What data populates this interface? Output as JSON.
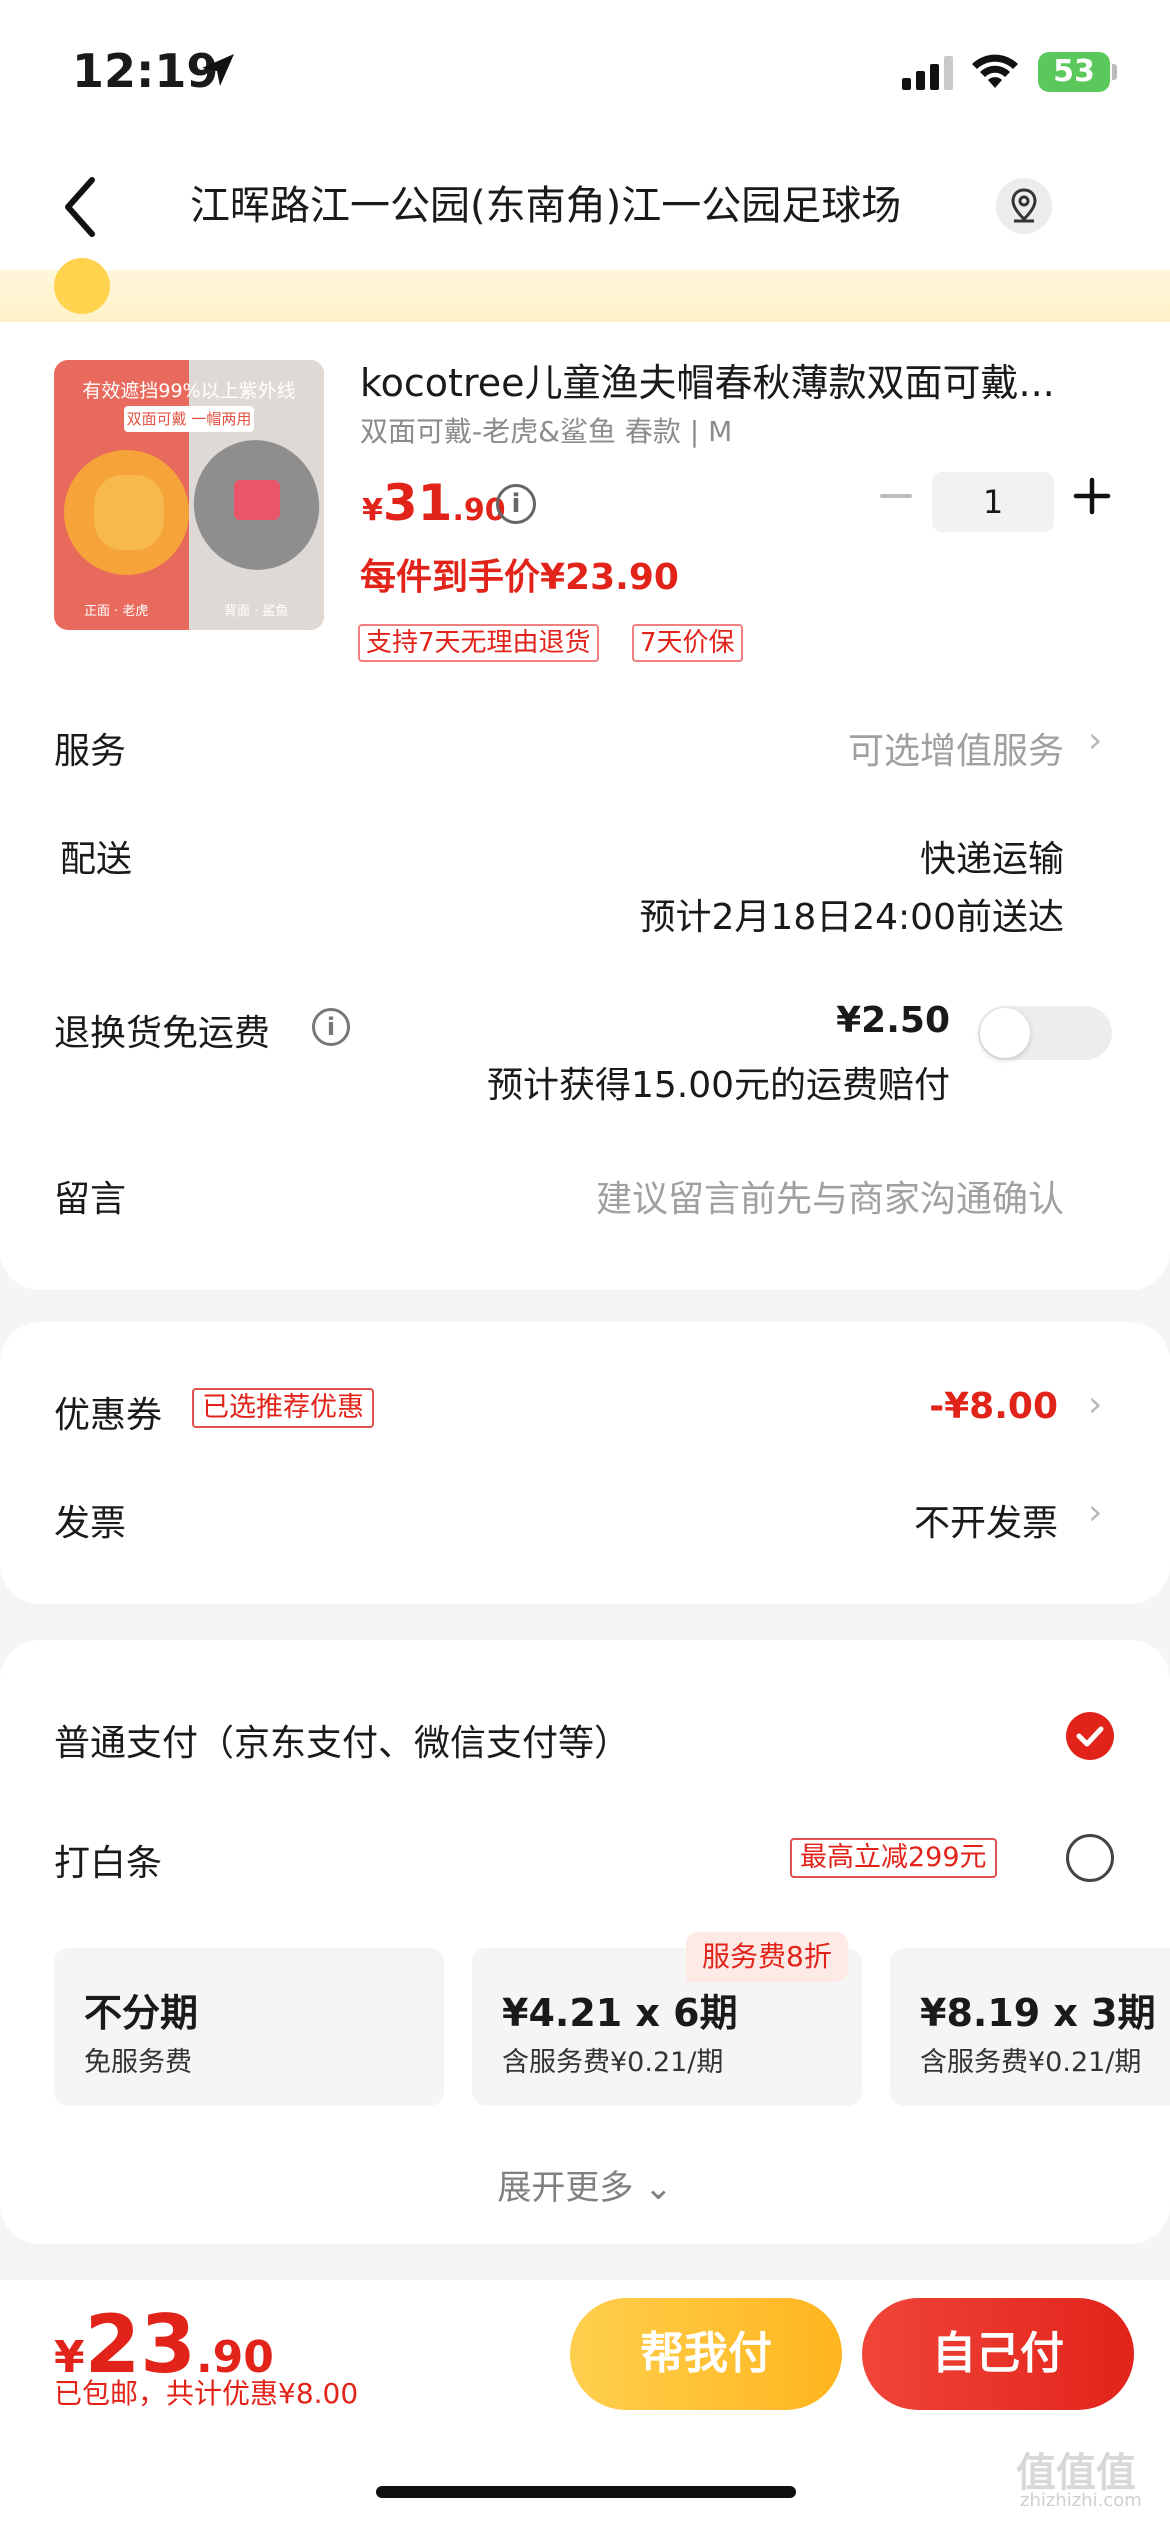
{
  "status": {
    "time": "12:19",
    "battery": "53"
  },
  "header": {
    "title": "江晖路江一公园(东南角)江一公园足球场"
  },
  "product": {
    "thumb_line1": "有效遮挡99%以上紫外线",
    "thumb_line2": "双面可戴 一帽两用",
    "thumb_label_left": "正面 · 老虎",
    "thumb_label_right": "背面 · 鲨鱼",
    "name": "kocotree儿童渔夫帽春秋薄款双面可戴...",
    "spec": "双面可戴-老虎&鲨鱼 春款 | M",
    "price_yen": "¥",
    "price_int": "31",
    "price_dec": ".90",
    "quantity": "1",
    "final_price": "每件到手价¥23.90",
    "tags": [
      "支持7天无理由退货",
      "7天价保"
    ]
  },
  "rows": {
    "service_label": "服务",
    "service_value": "可选增值服务",
    "delivery_label": "配送",
    "delivery_value": "快递运输",
    "delivery_eta": "预计2月18日24:00前送达",
    "return_label": "退换货免运费",
    "return_price": "¥2.50",
    "return_note": "预计获得15.00元的运费赔付",
    "message_label": "留言",
    "message_placeholder": "建议留言前先与商家沟通确认",
    "chevron": "›"
  },
  "discounts": {
    "coupon_label": "优惠券",
    "coupon_tag": "已选推荐优惠",
    "coupon_value": "-¥8.00",
    "invoice_label": "发票",
    "invoice_value": "不开发票"
  },
  "payment": {
    "normal_label": "普通支付（京东支付、微信支付等）",
    "baitiao_label": "打白条",
    "baitiao_tag": "最高立减299元",
    "plans": [
      {
        "title": "不分期",
        "sub": "免服务费"
      },
      {
        "title": "¥4.21 x 6期",
        "sub": "含服务费¥0.21/期"
      },
      {
        "title": "¥8.19 x 3期",
        "sub": "含服务费¥0.21/期"
      }
    ],
    "plan_badge": "服务费8折",
    "expand": "展开更多 ⌄"
  },
  "bottom": {
    "yen": "¥",
    "int": "23",
    "dec": ".90",
    "sub": "已包邮，共计优惠¥8.00",
    "help_btn": "帮我付",
    "self_btn": "自己付"
  },
  "watermark": {
    "main": "值值值",
    "sub": "zhizhizhi.com"
  },
  "colors": {
    "accent": "#e2231a",
    "yellow": "#ffc12e"
  }
}
